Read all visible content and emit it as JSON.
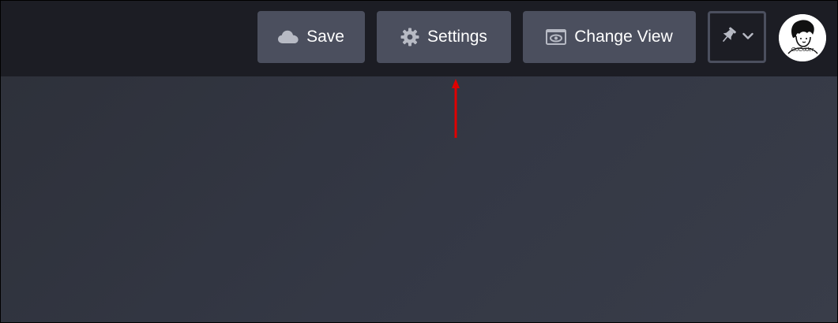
{
  "toolbar": {
    "save_label": "Save",
    "settings_label": "Settings",
    "change_view_label": "Change View"
  },
  "icons": {
    "save": "cloud-icon",
    "settings": "gear-icon",
    "change_view": "eye-icon",
    "pin": "pin-icon",
    "dropdown": "chevron-down-icon"
  },
  "user": {
    "avatar_text": "GoCoder"
  },
  "colors": {
    "topbar": "#1c1d24",
    "button_bg": "#4b4f5e",
    "icon_grey": "#b7bac4",
    "annotation_arrow": "#e00000"
  }
}
